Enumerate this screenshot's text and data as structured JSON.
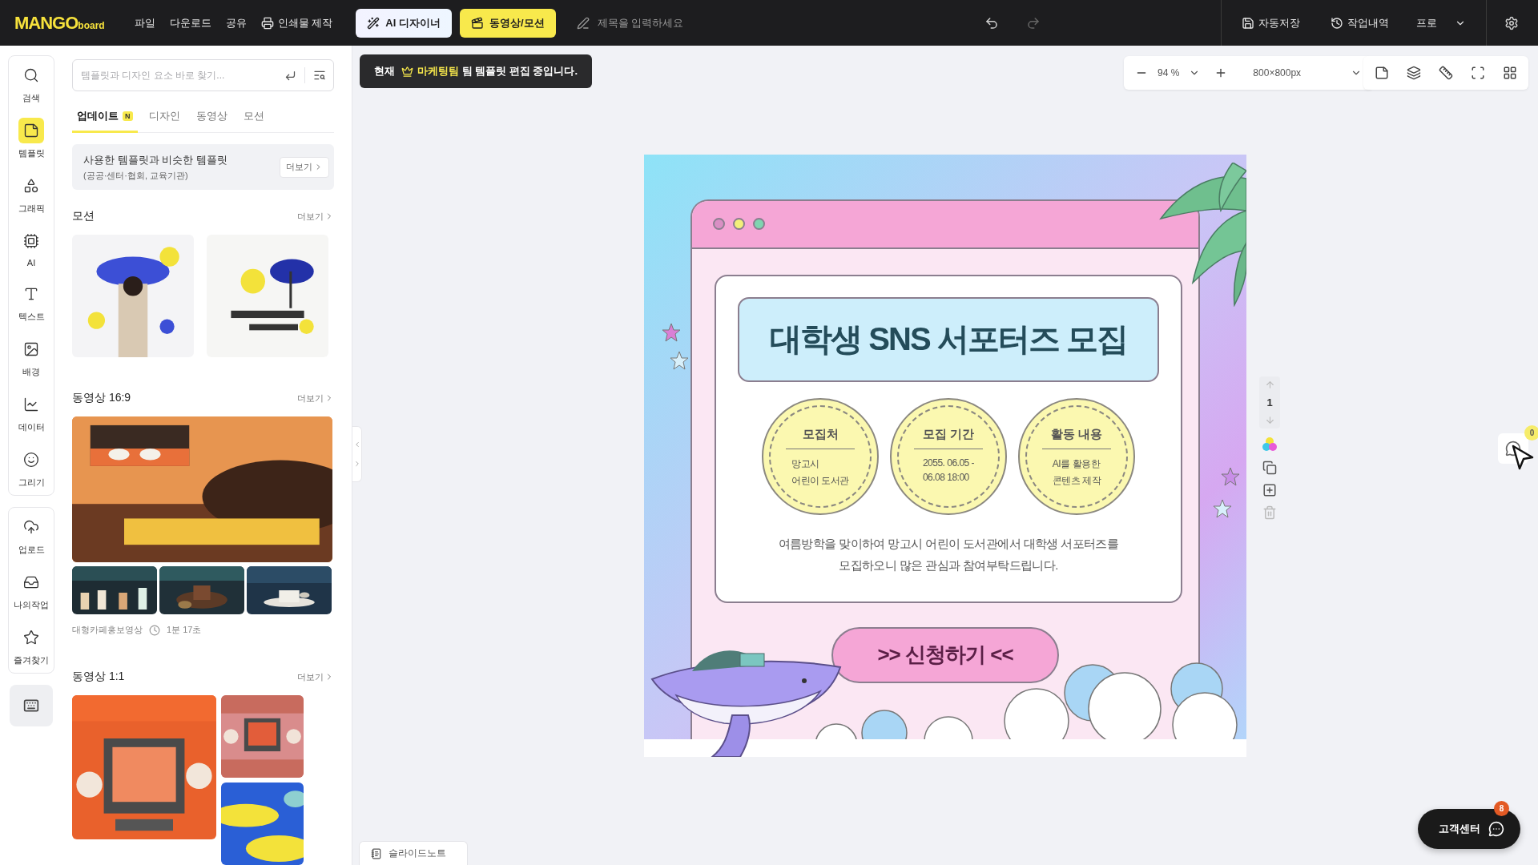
{
  "top_bar": {
    "logo": "MANGO",
    "logo_sub": "board",
    "menu": [
      "파일",
      "다운로드",
      "공유"
    ],
    "print_button": "인쇄물 제작",
    "ai_button": "AI 디자이너",
    "motion_button": "동영상/모션",
    "title_placeholder": "제목을 입력하세요",
    "autosave": "자동저장",
    "history": "작업내역",
    "plan": "프로"
  },
  "rail": {
    "groups": [
      [
        {
          "label": "검색",
          "selected": false
        },
        {
          "label": "템플릿",
          "selected": true
        },
        {
          "label": "그래픽",
          "selected": false
        },
        {
          "label": "AI",
          "selected": false
        },
        {
          "label": "텍스트",
          "selected": false
        },
        {
          "label": "배경",
          "selected": false
        },
        {
          "label": "데이터",
          "selected": false
        },
        {
          "label": "그리기",
          "selected": false
        }
      ],
      [
        {
          "label": "업로드",
          "selected": false
        },
        {
          "label": "나의작업",
          "selected": false
        },
        {
          "label": "즐겨찾기",
          "selected": false
        }
      ]
    ]
  },
  "panel": {
    "search_placeholder": "템플릿과 디자인 요소 바로 찾기...",
    "tabs": [
      {
        "label": "업데이트",
        "badge": "N",
        "selected": true
      },
      {
        "label": "디자인",
        "selected": false
      },
      {
        "label": "동영상",
        "selected": false
      },
      {
        "label": "모션",
        "selected": false
      }
    ],
    "suggestion": {
      "title": "사용한 템플릿과 비슷한 템플릿",
      "subtitle": "(공공·센터·협회, 교육기관)",
      "button": "더보기"
    },
    "sections": [
      {
        "kind": "motion",
        "title": "모션",
        "more": "더보기"
      },
      {
        "kind": "video_wide",
        "title": "동영상 16:9",
        "more": "더보기",
        "caption": "대형카페홍보영상",
        "duration": "1분 17초"
      },
      {
        "kind": "video_square",
        "title": "동영상 1:1",
        "more": "더보기"
      }
    ]
  },
  "banner": {
    "prefix": "현재",
    "team": "마케팅팀",
    "suffix": "팀 템플릿 편집 중입니다."
  },
  "zoom_bar": {
    "zoom": "94 %",
    "size": "800×800px"
  },
  "poster": {
    "title": "대학생 SNS 서포터즈 모집",
    "circles": [
      {
        "heading": "모집처",
        "lines": [
          "망고시",
          "어린이 도서관"
        ]
      },
      {
        "heading": "모집 기간",
        "lines": [
          "2055. 06.05 -",
          "06.08 18:00"
        ]
      },
      {
        "heading": "활동 내용",
        "lines": [
          "AI를 활용한",
          "콘텐츠 제작"
        ]
      }
    ],
    "body": [
      "여름방학을 맞이하여 망고시 어린이 도서관에서 대학생 서포터즈를",
      "모집하오니 많은 관심과 참여부탁드립니다."
    ],
    "cta": ">> 신청하기 <<"
  },
  "page_nav": {
    "page": "1"
  },
  "comments": {
    "count": "0"
  },
  "support": {
    "label": "고객센터",
    "count": "8"
  },
  "slide_note": "슬라이드노트"
}
